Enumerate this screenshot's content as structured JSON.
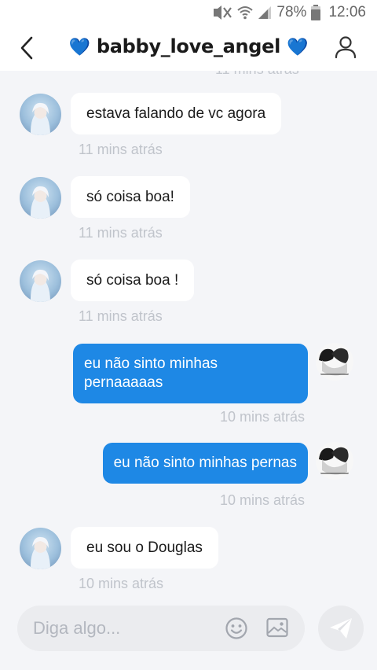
{
  "status_bar": {
    "battery_percent": "78%",
    "time": "12:06",
    "icons": [
      "mute-icon",
      "wifi-icon",
      "signal-icon",
      "battery-icon"
    ]
  },
  "header": {
    "title": "babby_love_angel",
    "title_emoji": "💙",
    "back_icon": "chevron-left-icon",
    "profile_icon": "person-icon"
  },
  "chat": {
    "cutoff_timestamp": "11 mins atrás",
    "messages": [
      {
        "side": "in",
        "text": "estava falando de vc agora",
        "time": "11 mins atrás"
      },
      {
        "side": "in",
        "text": "só coisa boa!",
        "time": "11 mins atrás"
      },
      {
        "side": "in",
        "text": "só coisa boa !",
        "time": "11 mins atrás"
      },
      {
        "side": "out",
        "text": "eu não sinto minhas pernaaaaas",
        "time": "10 mins atrás"
      },
      {
        "side": "out",
        "text": "eu não sinto minhas pernas",
        "time": "10 mins atrás"
      },
      {
        "side": "in",
        "text": "eu sou o Douglas",
        "time": "10 mins atrás"
      }
    ]
  },
  "composer": {
    "placeholder": "Diga algo...",
    "value": "",
    "emoji_icon": "smiley-icon",
    "image_icon": "image-icon",
    "send_icon": "paper-plane-icon"
  },
  "colors": {
    "outgoing_bubble": "#1e88e5",
    "incoming_bubble": "#ffffff",
    "heart": "#1e8fe6",
    "background": "#f4f5f8"
  }
}
